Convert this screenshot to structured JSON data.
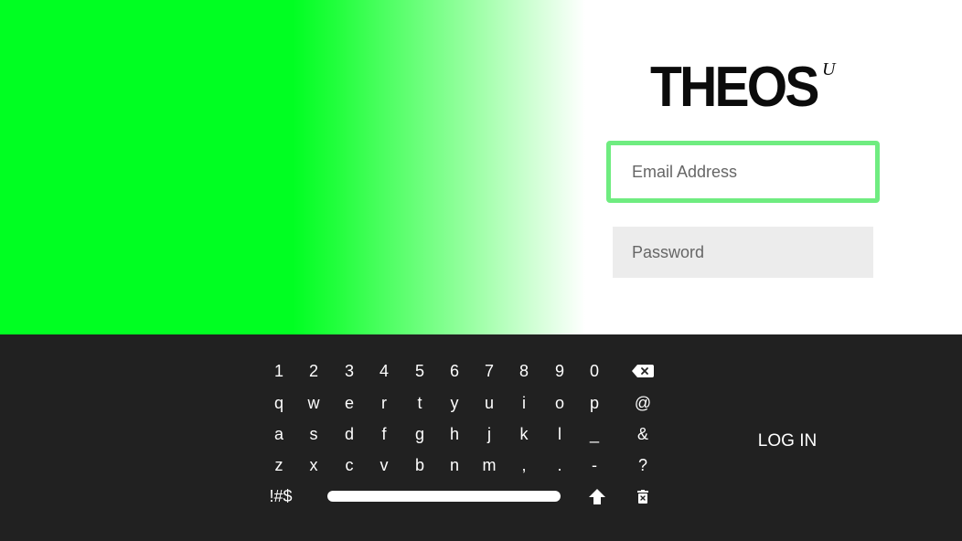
{
  "brand": {
    "logo_text": "THEOS",
    "logo_superscript": "U"
  },
  "login_form": {
    "email_placeholder": "Email Address",
    "password_placeholder": "Password",
    "login_label": "LOG IN"
  },
  "keyboard": {
    "row_numbers": [
      "1",
      "2",
      "3",
      "4",
      "5",
      "6",
      "7",
      "8",
      "9",
      "0"
    ],
    "row_1": [
      "q",
      "w",
      "e",
      "r",
      "t",
      "y",
      "u",
      "i",
      "o",
      "p"
    ],
    "row_2": [
      "a",
      "s",
      "d",
      "f",
      "g",
      "h",
      "j",
      "k",
      "l",
      "_"
    ],
    "row_3": [
      "z",
      "x",
      "c",
      "v",
      "b",
      "n",
      "m",
      ",",
      ".",
      "-"
    ],
    "side_keys": [
      "@",
      "&",
      "?"
    ],
    "symbols_label": "!#$",
    "icons": {
      "backspace": "backspace-icon",
      "shift": "shift-arrow-icon",
      "clear": "trash-icon"
    }
  },
  "colors": {
    "green_accent": "#00ff22",
    "focus_border": "#6fec80",
    "keyboard_bg": "#212121"
  }
}
